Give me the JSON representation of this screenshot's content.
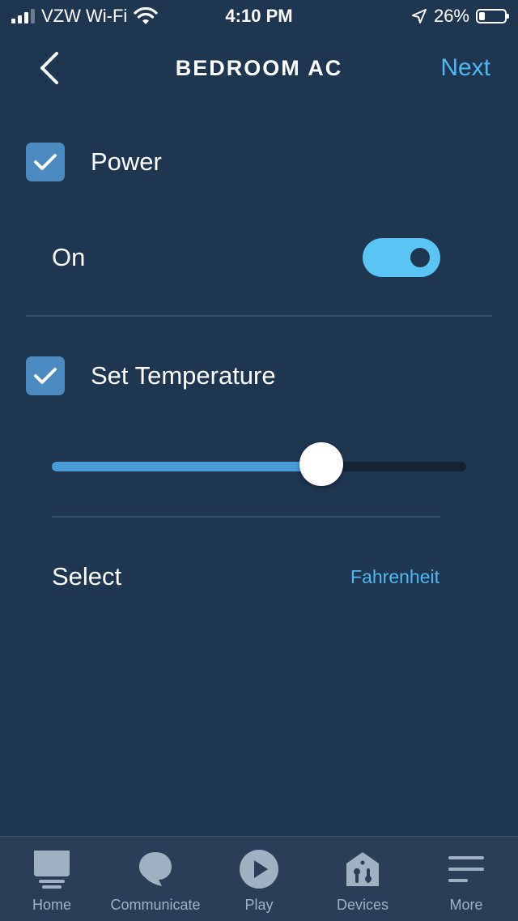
{
  "status_bar": {
    "carrier": "VZW Wi-Fi",
    "time": "4:10 PM",
    "battery": "26%",
    "battery_level": 0.26
  },
  "header": {
    "title": "BEDROOM AC",
    "next_label": "Next"
  },
  "power": {
    "label": "Power",
    "checked": true,
    "state_label": "On",
    "toggle_on": true
  },
  "temperature": {
    "label": "Set Temperature",
    "checked": true,
    "slider_value": 0.65,
    "select_label": "Select",
    "unit": "Fahrenheit"
  },
  "tabs": [
    {
      "label": "Home",
      "icon": "home-icon"
    },
    {
      "label": "Communicate",
      "icon": "chat-bubble-icon"
    },
    {
      "label": "Play",
      "icon": "play-icon"
    },
    {
      "label": "Devices",
      "icon": "devices-icon"
    },
    {
      "label": "More",
      "icon": "menu-icon"
    }
  ],
  "colors": {
    "background": "#1f3651",
    "accent": "#4fb8f0",
    "toggle_on": "#5ac5f5",
    "checkbox": "#4a8ac0"
  }
}
